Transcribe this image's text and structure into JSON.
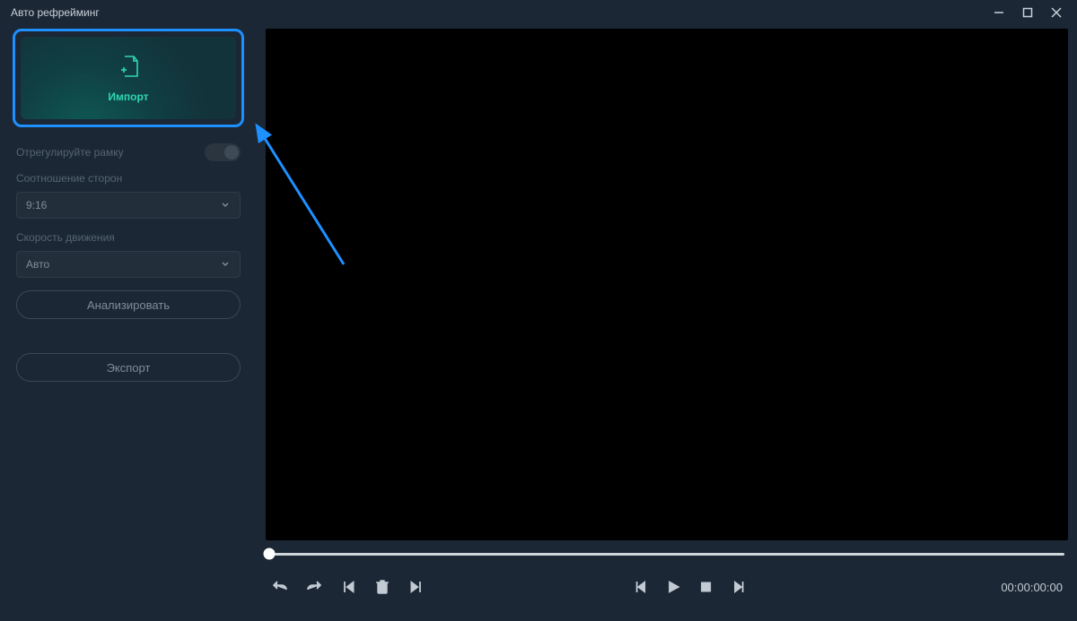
{
  "window": {
    "title": "Авто рефрейминг"
  },
  "sidebar": {
    "import_label": "Импорт",
    "adjust_frame_label": "Отрегулируйте рамку",
    "adjust_frame_on": false,
    "aspect_ratio_label": "Соотношение сторон",
    "aspect_ratio_value": "9:16",
    "motion_speed_label": "Скорость движения",
    "motion_speed_value": "Авто",
    "analyze_label": "Анализировать",
    "export_label": "Экспорт"
  },
  "player": {
    "timestamp": "00:00:00:00"
  }
}
